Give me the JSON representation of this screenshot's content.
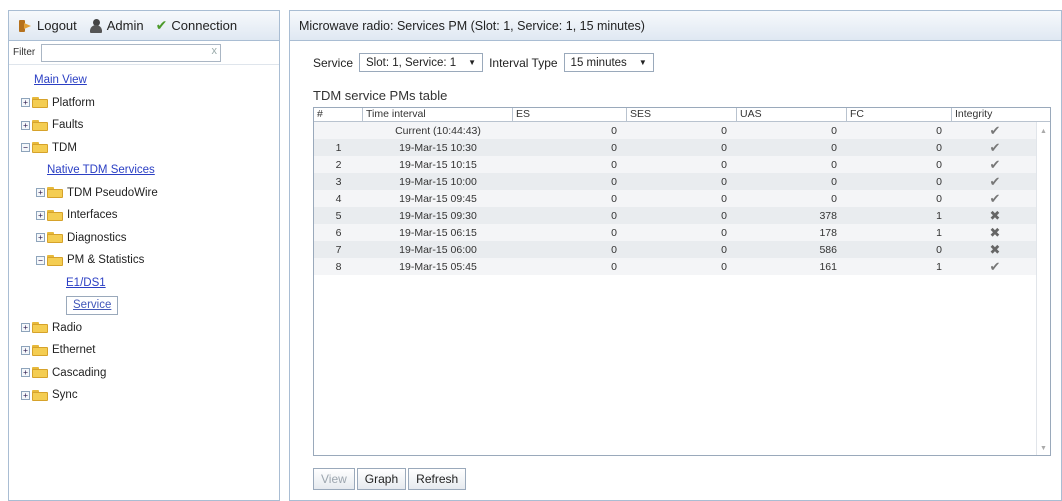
{
  "left_panel": {
    "toolbar": {
      "logout_label": "Logout",
      "admin_label": "Admin",
      "connection_label": "Connection"
    },
    "filter": {
      "label": "Filter",
      "value": "",
      "clear_icon": "x"
    },
    "tree": {
      "main_view": "Main View",
      "platform": "Platform",
      "faults": "Faults",
      "tdm": "TDM",
      "native_tdm_services": "Native TDM Services",
      "tdm_pseudowire": "TDM PseudoWire",
      "interfaces": "Interfaces",
      "diagnostics": "Diagnostics",
      "pm_statistics": "PM & Statistics",
      "e1ds1": "E1/DS1",
      "service": "Service",
      "radio": "Radio",
      "ethernet": "Ethernet",
      "cascading": "Cascading",
      "sync": "Sync"
    }
  },
  "main": {
    "title": "Microwave radio: Services PM (Slot: 1, Service: 1, 15 minutes)",
    "service_label": "Service",
    "service_value": "Slot: 1, Service: 1",
    "interval_label": "Interval Type",
    "interval_value": "15 minutes",
    "table_title": "TDM service PMs table",
    "columns": [
      "#",
      "Time interval",
      "ES",
      "SES",
      "UAS",
      "FC",
      "Integrity"
    ],
    "rows": [
      {
        "num": "",
        "time": "Current (10:44:43)",
        "es": "0",
        "ses": "0",
        "uas": "0",
        "fc": "0",
        "integrity": "ok"
      },
      {
        "num": "1",
        "time": "19-Mar-15 10:30",
        "es": "0",
        "ses": "0",
        "uas": "0",
        "fc": "0",
        "integrity": "ok"
      },
      {
        "num": "2",
        "time": "19-Mar-15 10:15",
        "es": "0",
        "ses": "0",
        "uas": "0",
        "fc": "0",
        "integrity": "ok"
      },
      {
        "num": "3",
        "time": "19-Mar-15 10:00",
        "es": "0",
        "ses": "0",
        "uas": "0",
        "fc": "0",
        "integrity": "ok"
      },
      {
        "num": "4",
        "time": "19-Mar-15 09:45",
        "es": "0",
        "ses": "0",
        "uas": "0",
        "fc": "0",
        "integrity": "ok"
      },
      {
        "num": "5",
        "time": "19-Mar-15 09:30",
        "es": "0",
        "ses": "0",
        "uas": "378",
        "fc": "1",
        "integrity": "fail"
      },
      {
        "num": "6",
        "time": "19-Mar-15 06:15",
        "es": "0",
        "ses": "0",
        "uas": "178",
        "fc": "1",
        "integrity": "fail"
      },
      {
        "num": "7",
        "time": "19-Mar-15 06:00",
        "es": "0",
        "ses": "0",
        "uas": "586",
        "fc": "0",
        "integrity": "fail"
      },
      {
        "num": "8",
        "time": "19-Mar-15 05:45",
        "es": "0",
        "ses": "0",
        "uas": "161",
        "fc": "1",
        "integrity": "ok"
      }
    ],
    "buttons": {
      "view": "View",
      "graph": "Graph",
      "refresh": "Refresh"
    }
  },
  "colors": {
    "link": "#2b3fc4",
    "panel_header": "#dfe8f2",
    "folder": "#f4cd52"
  },
  "icons": {
    "logout": "logout-icon",
    "admin": "admin-user-icon",
    "connection": "check-icon",
    "folder": "folder-icon",
    "integrity_ok": "checkmark-icon",
    "integrity_fail": "cross-icon"
  }
}
